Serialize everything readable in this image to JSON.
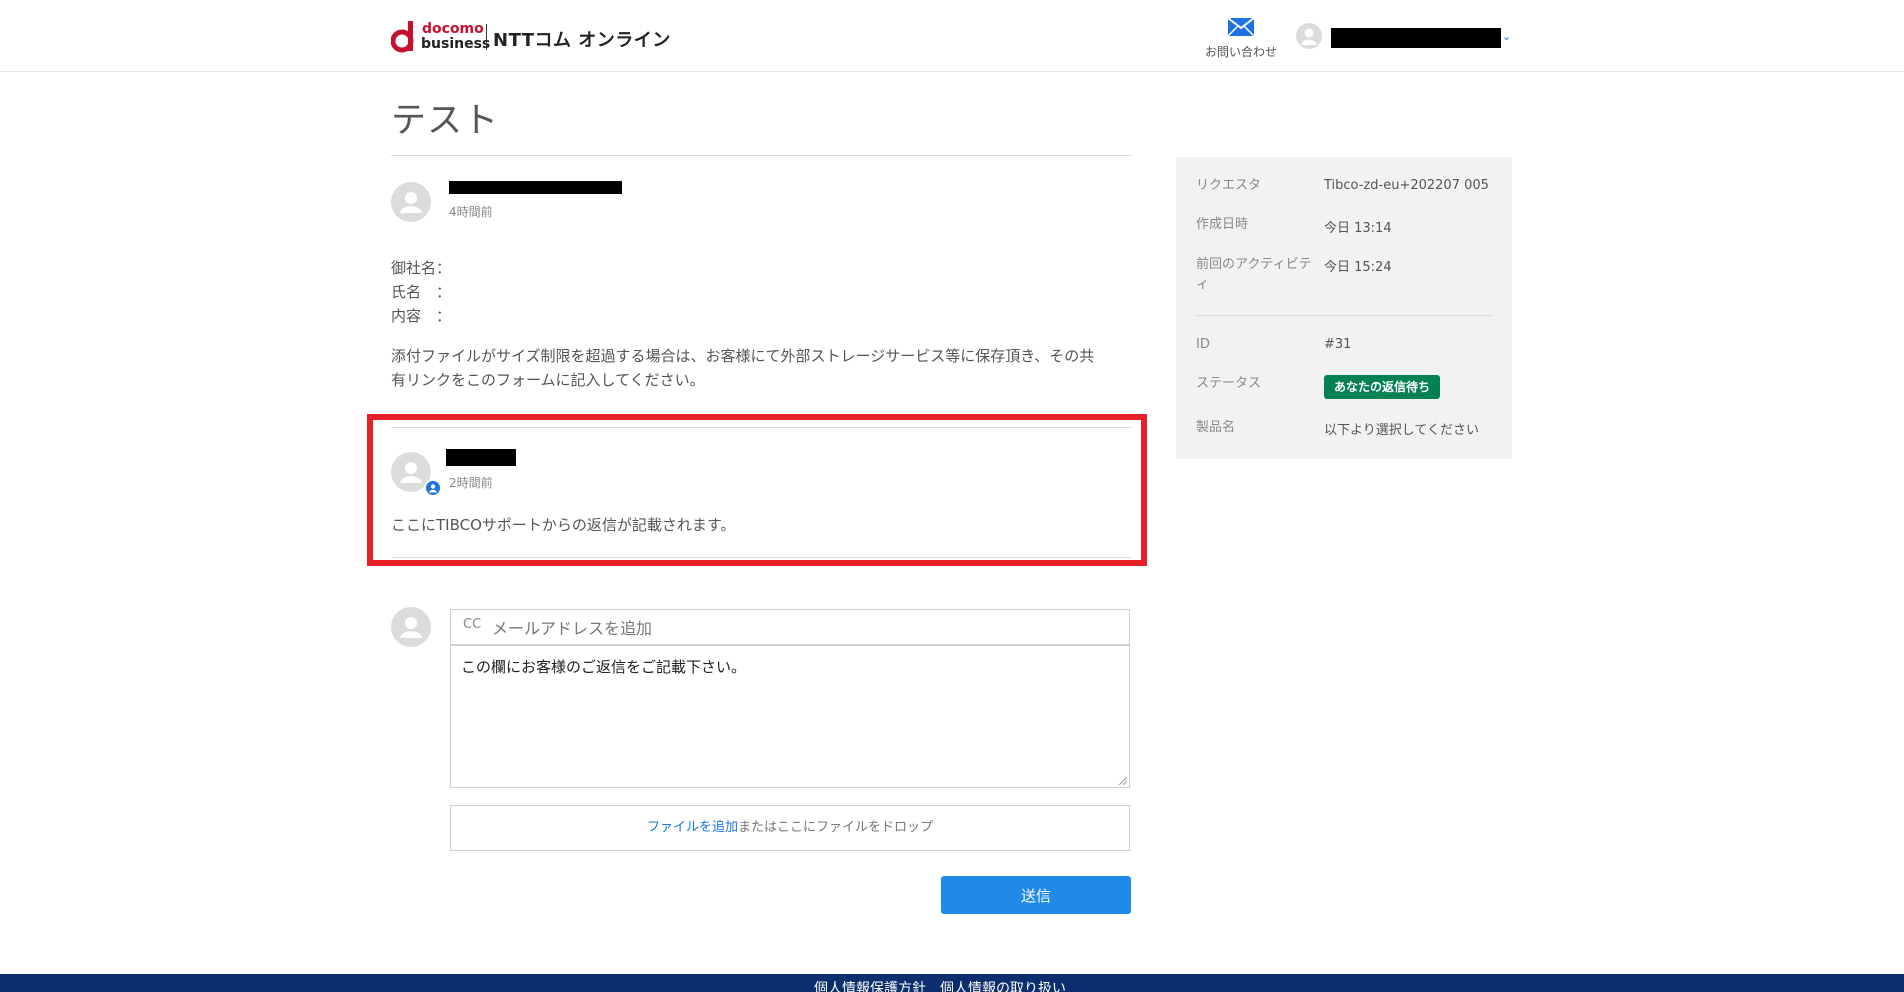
{
  "header": {
    "logo_docomo": "docomo",
    "logo_business": "business",
    "logo_brand": "NTTコム オンライン",
    "contact_label": "お問い合わせ",
    "user_menu_chevron": "⌄"
  },
  "page": {
    "title": "テスト"
  },
  "comments": [
    {
      "time": "4時間前",
      "lines": [
        "御社名：",
        "氏名　：",
        "内容　："
      ],
      "paragraph_line1": "添付ファイルがサイズ制限を超過する場合は、お客様にて外部ストレージサービス等に保存頂き、その共",
      "paragraph_line2": "有リンクをこのフォームに記入してください。"
    },
    {
      "time": "2時間前",
      "text": "ここにTIBCOサポートからの返信が記載されます。"
    }
  ],
  "reply_form": {
    "cc_label": "CC",
    "cc_placeholder": "メールアドレスを追加",
    "reply_value": "この欄にお客様のご返信をご記載下さい。",
    "upload_link": "ファイルを追加",
    "upload_text": "またはここにファイルをドロップ",
    "submit_label": "送信"
  },
  "sidebar": {
    "requester_label": "リクエスタ",
    "requester_value": "Tibco-zd-eu+202207 005",
    "created_label": "作成日時",
    "created_value": "今日 13:14",
    "last_activity_label_1": "前回のアクティビテ",
    "last_activity_label_2": "ィ",
    "last_activity_value": "今日 15:24",
    "id_label": "ID",
    "id_value": "#31",
    "status_label": "ステータス",
    "status_value": "あなたの返信待ち",
    "product_label": "製品名",
    "product_value": "以下より選択してください"
  },
  "footer": {
    "links": "個人情報保護方針　個人情報の取り扱い"
  },
  "colors": {
    "accent_blue": "#1f8ae8",
    "highlight_red": "#e8202a",
    "status_green": "#038153",
    "footer_navy": "#0b2e6e",
    "docomo_red": "#c8102e"
  }
}
